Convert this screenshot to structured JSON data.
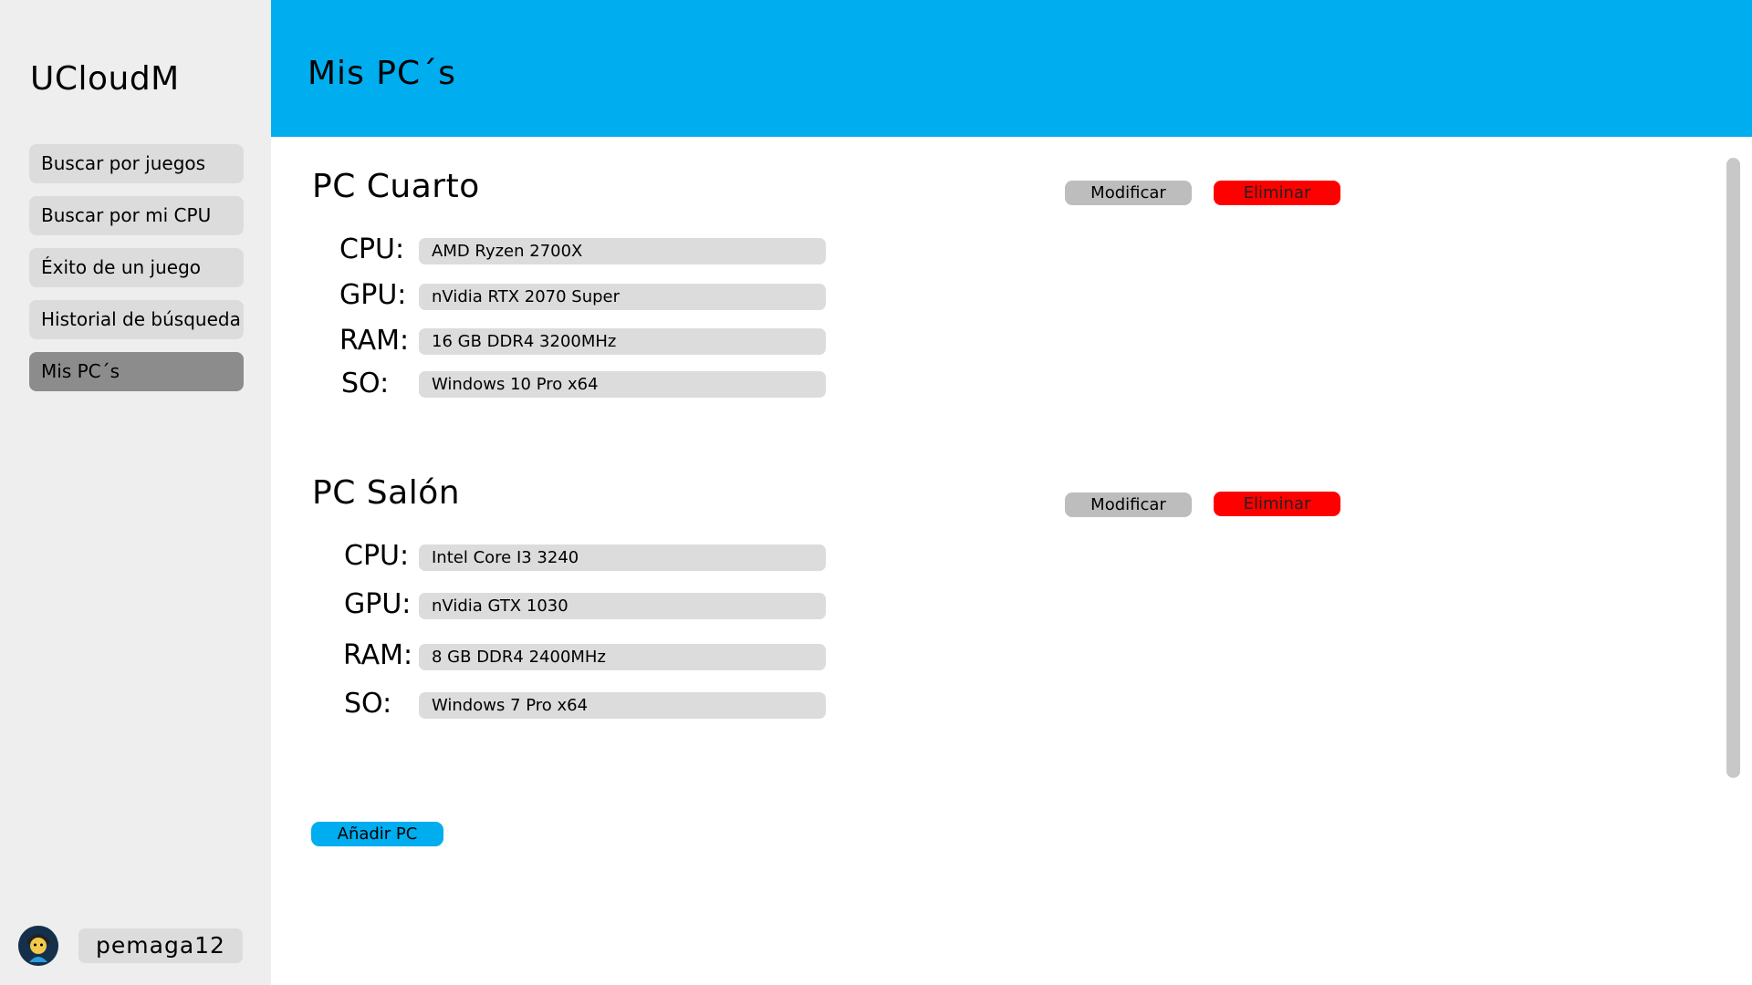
{
  "app": {
    "title": "UCloudM"
  },
  "sidebar": {
    "items": [
      {
        "label": "Buscar por juegos"
      },
      {
        "label": "Buscar por mi CPU"
      },
      {
        "label": "Éxito de un juego"
      },
      {
        "label": "Historial de búsqueda"
      },
      {
        "label": "Mis PC´s",
        "active": true
      }
    ],
    "user": {
      "username": "pemaga12"
    }
  },
  "header": {
    "title": "Mis PC´s"
  },
  "pcs": [
    {
      "name": "PC Cuarto",
      "modify_label": "Modificar",
      "delete_label": "Eliminar",
      "specs": [
        {
          "label": "CPU:",
          "value": "AMD Ryzen 2700X"
        },
        {
          "label": "GPU:",
          "value": "nVidia RTX 2070 Super"
        },
        {
          "label": "RAM:",
          "value": "16 GB DDR4 3200MHz"
        },
        {
          "label": "SO:",
          "value": "Windows 10 Pro x64"
        }
      ]
    },
    {
      "name": "PC Salón",
      "modify_label": "Modificar",
      "delete_label": "Eliminar",
      "specs": [
        {
          "label": "CPU:",
          "value": "Intel Core I3 3240"
        },
        {
          "label": "GPU:",
          "value": "nVidia GTX 1030"
        },
        {
          "label": "RAM:",
          "value": "8 GB DDR4 2400MHz"
        },
        {
          "label": "SO:",
          "value": "Windows 7 Pro x64"
        }
      ]
    }
  ],
  "actions": {
    "add_pc_label": "Añadir PC"
  },
  "colors": {
    "accent": "#00adef",
    "danger": "#ff0000",
    "sidebar_bg": "#eeeeee",
    "field_bg": "#dcdcdc",
    "active_nav": "#8c8c8c"
  }
}
